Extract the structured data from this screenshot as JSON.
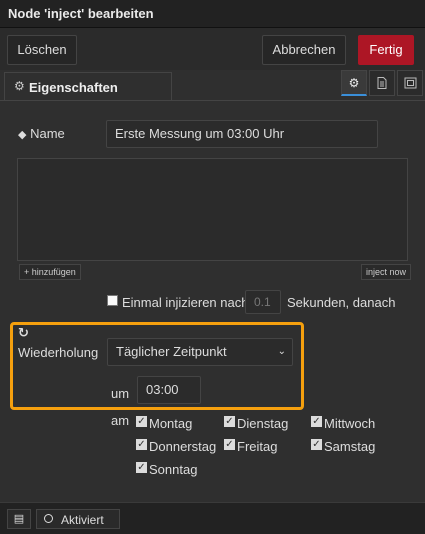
{
  "window": {
    "title": "Node 'inject' bearbeiten"
  },
  "toolbar": {
    "delete_label": "Löschen",
    "cancel_label": "Abbrechen",
    "done_label": "Fertig"
  },
  "tabs": {
    "properties_label": "Eigenschaften",
    "icons": [
      "gear-icon",
      "description-icon",
      "appearance-icon"
    ]
  },
  "form": {
    "name_label": "Name",
    "name_value": "Erste Messung um 03:00 Uhr",
    "add_button": "+ hinzufügen",
    "inject_now_button": "inject now",
    "once_label": "Einmal injizieren nach",
    "once_placeholder": "0.1",
    "once_suffix": "Sekunden, danach",
    "repeat_label": "Wiederholung",
    "repeat_value": "Täglicher Zeitpunkt",
    "at_label": "um",
    "time_value": "03:00",
    "days_label": "am",
    "days": [
      {
        "label": "Montag",
        "checked": true
      },
      {
        "label": "Dienstag",
        "checked": true
      },
      {
        "label": "Mittwoch",
        "checked": true
      },
      {
        "label": "Donnerstag",
        "checked": true
      },
      {
        "label": "Freitag",
        "checked": true
      },
      {
        "label": "Samstag",
        "checked": true
      },
      {
        "label": "Sonntag",
        "checked": true
      }
    ]
  },
  "footer": {
    "enabled_label": "Aktiviert"
  },
  "colors": {
    "primary": "#ad1625",
    "highlight": "#f5a00e",
    "background": "#2f2f2f"
  }
}
